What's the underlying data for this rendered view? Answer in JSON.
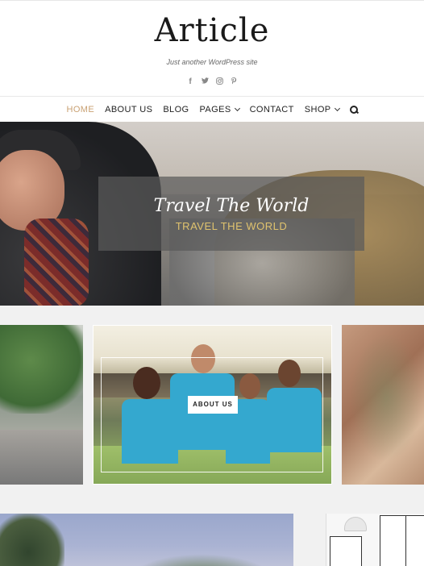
{
  "site": {
    "title": "Article",
    "tagline": "Just another WordPress site"
  },
  "socials": [
    {
      "name": "facebook-icon",
      "glyph": "f"
    },
    {
      "name": "twitter-icon",
      "glyph": "🐦"
    },
    {
      "name": "instagram-icon",
      "glyph": "◎"
    },
    {
      "name": "pinterest-icon",
      "glyph": "℗"
    }
  ],
  "nav": {
    "home": "HOME",
    "about": "ABOUT US",
    "blog": "BLOG",
    "pages": "PAGES",
    "contact": "CONTACT",
    "shop": "SHOP"
  },
  "hero": {
    "title": "Travel The World",
    "subtitle": "TRAVEL THE WORLD"
  },
  "cards": {
    "center_button": "ABOUT US"
  },
  "colors": {
    "accent": "#c9a173",
    "hero_sub": "#e0c36e",
    "volunteer_shirt": "#34a8cf"
  }
}
